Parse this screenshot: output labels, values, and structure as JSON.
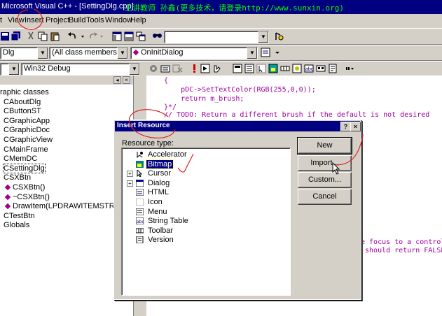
{
  "window": {
    "title": "Microsoft Visual C++ - [SettingDlg.cpp]",
    "banner": "主讲教师 孙鑫(更多技术，请登录http://www.sunxin.org)"
  },
  "menu": {
    "items": [
      {
        "label": "t"
      },
      {
        "label": "View"
      },
      {
        "label": "Insert"
      },
      {
        "label": "Project"
      },
      {
        "label": "Build"
      },
      {
        "label": "Tools"
      },
      {
        "label": "Window"
      },
      {
        "label": "Help"
      }
    ]
  },
  "toolbar2": {
    "class_combo": "Dlg",
    "members_combo": "(All class members)",
    "function_combo": "OnInitDialog"
  },
  "toolbar3": {
    "config_combo": "Win32 Debug"
  },
  "class_tree": {
    "items": [
      {
        "label": "raphic classes",
        "indent": 0,
        "type": "root"
      },
      {
        "label": "CAboutDlg",
        "indent": 1,
        "type": "class"
      },
      {
        "label": "CButtonST",
        "indent": 1,
        "type": "class"
      },
      {
        "label": "CGraphicApp",
        "indent": 1,
        "type": "class"
      },
      {
        "label": "CGraphicDoc",
        "indent": 1,
        "type": "class"
      },
      {
        "label": "CGraphicView",
        "indent": 1,
        "type": "class"
      },
      {
        "label": "CMainFrame",
        "indent": 1,
        "type": "class"
      },
      {
        "label": "CMemDC",
        "indent": 1,
        "type": "class"
      },
      {
        "label": "CSettingDlg",
        "indent": 1,
        "type": "class-selected"
      },
      {
        "label": "CSXBtn",
        "indent": 1,
        "type": "class"
      },
      {
        "label": "CSXBtn()",
        "indent": 2,
        "type": "method"
      },
      {
        "label": "~CSXBtn()",
        "indent": 2,
        "type": "method"
      },
      {
        "label": "DrawItem(LPDRAWITEMSTRU",
        "indent": 2,
        "type": "method"
      },
      {
        "label": "CTestBtn",
        "indent": 1,
        "type": "class"
      },
      {
        "label": "Globals",
        "indent": 1,
        "type": "class"
      }
    ]
  },
  "editor": {
    "lines": [
      "{",
      "    pDC->SetTextColor(RGB(255,0,0));",
      "    return m_brush;",
      "}*/",
      "// TODO: Return a different brush if the default is not desired"
    ],
    "right_lines": [
      "e focus to a control",
      " should return FALSE"
    ]
  },
  "dialog": {
    "title": "Insert Resource",
    "help_glyph": "?",
    "close_glyph": "×",
    "resource_label": "Resource type:",
    "resources": [
      {
        "label": "Accelerator",
        "icon": "accelerator-icon",
        "expandable": false,
        "selected": false
      },
      {
        "label": "Bitmap",
        "icon": "bitmap-icon",
        "expandable": false,
        "selected": true
      },
      {
        "label": "Cursor",
        "icon": "cursor-icon",
        "expandable": true,
        "selected": false
      },
      {
        "label": "Dialog",
        "icon": "dialog-icon",
        "expandable": true,
        "selected": false
      },
      {
        "label": "HTML",
        "icon": "html-icon",
        "expandable": false,
        "selected": false
      },
      {
        "label": "Icon",
        "icon": "icon-resource-icon",
        "expandable": false,
        "selected": false
      },
      {
        "label": "Menu",
        "icon": "menu-icon",
        "expandable": false,
        "selected": false
      },
      {
        "label": "String Table",
        "icon": "string-table-icon",
        "expandable": false,
        "selected": false
      },
      {
        "label": "Toolbar",
        "icon": "toolbar-icon",
        "expandable": false,
        "selected": false
      },
      {
        "label": "Version",
        "icon": "version-icon",
        "expandable": false,
        "selected": false
      }
    ],
    "buttons": {
      "new": "New",
      "import": "Import...",
      "custom": "Custom...",
      "cancel": "Cancel"
    }
  },
  "colors": {
    "titlebar": "#000080",
    "banner_text": "#00ff00",
    "code_text": "#a000a0",
    "annotation_red": "#e02020"
  }
}
